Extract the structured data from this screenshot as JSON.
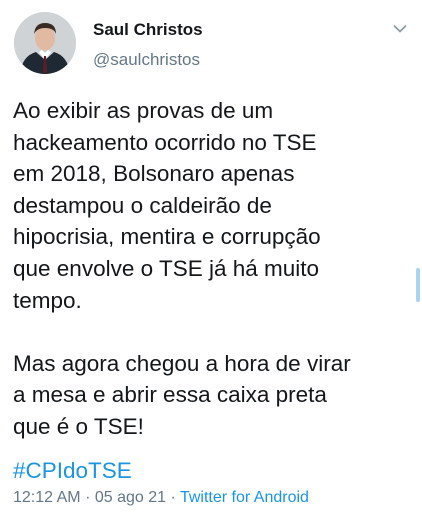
{
  "author": {
    "display_name": "Saul Christos",
    "handle": "@saulchristos"
  },
  "tweet": {
    "text": "Ao exibir as provas de um\nhackeamento ocorrido no TSE\nem 2018, Bolsonaro apenas\ndestampou o caldeirão de\nhipocrisia, mentira e corrupção\nque envolve o TSE já há muito\ntempo.\n\nMas agora chegou a hora de virar\na mesa e abrir essa caixa preta\nque é o TSE!",
    "hashtag": "#CPIdoTSE"
  },
  "meta": {
    "time": "12:12 AM",
    "separator": "·",
    "date": "05 ago 21",
    "source": "Twitter for Android"
  },
  "icons": {
    "menu": "chevron-down-icon"
  },
  "colors": {
    "link": "#1b95e0",
    "secondary": "#657786",
    "text": "#14171a"
  }
}
